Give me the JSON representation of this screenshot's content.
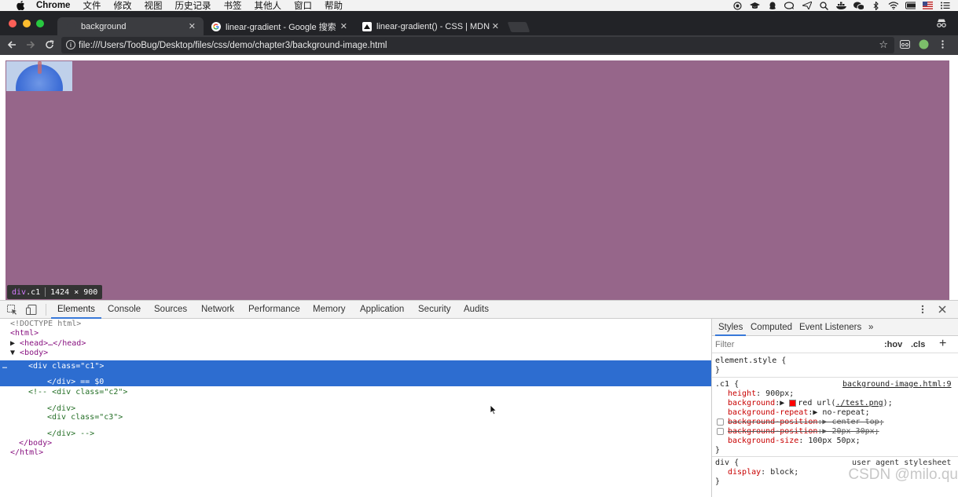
{
  "menubar": {
    "items": [
      "Chrome",
      "文件",
      "修改",
      "视图",
      "历史记录",
      "书签",
      "其他人",
      "窗口",
      "帮助"
    ]
  },
  "tabs": [
    {
      "title": "background",
      "active": true
    },
    {
      "title": "linear-gradient - Google 搜索",
      "active": false
    },
    {
      "title": "linear-gradient() - CSS | MDN",
      "active": false
    }
  ],
  "address": {
    "url": "file:///Users/TooBug/Desktop/files/css/demo/chapter3/background-image.html"
  },
  "page": {
    "div_color": "#96668a",
    "tooltip_tag": "div",
    "tooltip_class": ".c1",
    "tooltip_size": "1424 × 900"
  },
  "devtools": {
    "tabs": [
      "Elements",
      "Console",
      "Sources",
      "Network",
      "Performance",
      "Memory",
      "Application",
      "Security",
      "Audits"
    ],
    "dom": {
      "doctype": "<!DOCTYPE html>",
      "html_open": "<html>",
      "head": "<head>…</head>",
      "body_open": "<body>",
      "div_c1_open_tag": "<div",
      "div_c1_attr": "class",
      "div_c1_val": "\"c1\"",
      "div_c1_close": "</div>",
      "div_c1_eq": "== $0",
      "comment_1": "<!-- <div class=\"c2\">",
      "comment_2": "</div>",
      "comment_3": "<div class=\"c3\">",
      "comment_4": "</div> -->",
      "body_close": "</body>",
      "html_close": "</html>"
    },
    "styles_tabs": [
      "Styles",
      "Computed",
      "Event Listeners"
    ],
    "filter_placeholder": "Filter",
    "hov": ":hov",
    "cls": ".cls",
    "element_style": "element.style {",
    "close_brace": "}",
    "c1_selector": ".c1 {",
    "c1_source": "background-image.html:9",
    "props": {
      "height_name": "height",
      "height_val": "900px;",
      "bg_name": "background",
      "bg_val_a": "red url(",
      "bg_url": "./test.png",
      "bg_val_b": ");",
      "repeat_name": "background-repeat",
      "repeat_val": "no-repeat;",
      "pos1_name": "background-position",
      "pos1_val": "center top;",
      "pos2_name": "background-position",
      "pos2_val": "20px 30px;",
      "size_name": "background-size",
      "size_val": "100px 50px;"
    },
    "div_selector": "div {",
    "ua_label": "user agent stylesheet",
    "display_name": "display",
    "display_val": "block;"
  },
  "watermark": "CSDN @milo.qu"
}
